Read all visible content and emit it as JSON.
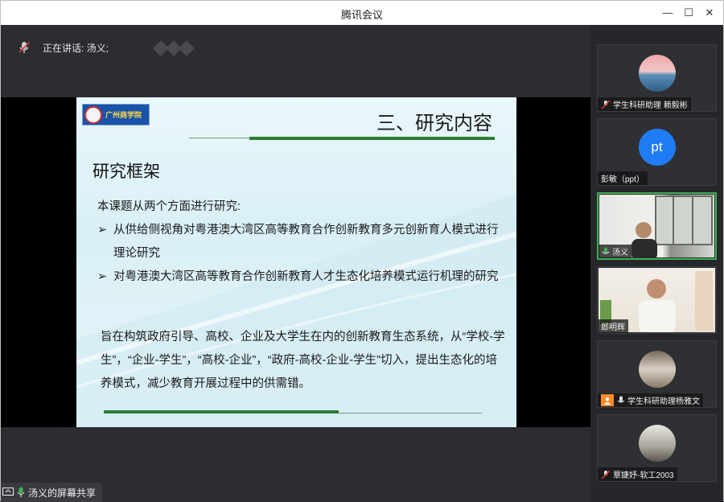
{
  "window": {
    "title": "腾讯会议"
  },
  "speaker": {
    "label": "正在讲话: 汤义;"
  },
  "slide": {
    "logo_text": "广州商学院",
    "title": "三、研究内容",
    "section": "研究框架",
    "intro": "本课题从两个方面进行研究:",
    "bullets": [
      "从供给侧视角对粤港澳大湾区高等教育合作创新教育多元创新育人模式进行理论研究",
      "对粤港澳大湾区高等教育合作创新教育人才生态化培养模式运行机理的研究"
    ],
    "bullet_marker": "➢",
    "paragraph": "旨在构筑政府引导、高校、企业及大学生在内的创新教育生态系统，从“学校-学生”，“企业-学生”，“高校-企业”，“政府-高校-企业-学生”切入，提出生态化的培养模式，减少教育开展过程中的供需错。"
  },
  "share": {
    "label": "汤义的屏幕共享"
  },
  "participants": [
    {
      "name": "学生科研助理 赖毅彬",
      "mic": "muted",
      "avatar": "photo-sea"
    },
    {
      "name": "彭敏（ppt）",
      "mic": "none",
      "avatar_text": "pt"
    },
    {
      "name": "汤义",
      "mic": "active",
      "avatar": "video-room",
      "active": true
    },
    {
      "name": "郎明辉",
      "mic": "none",
      "avatar": "video-man"
    },
    {
      "name": "学生科研助理杨雅文",
      "mic": "on",
      "avatar": "photo-group"
    },
    {
      "name": "覃婕妤-软工2003",
      "mic": "muted",
      "avatar": "photo-robot"
    }
  ],
  "colors": {
    "accent_green": "#3db152",
    "pt_blue": "#1f7cf5",
    "slide_green": "#2e7d32"
  }
}
